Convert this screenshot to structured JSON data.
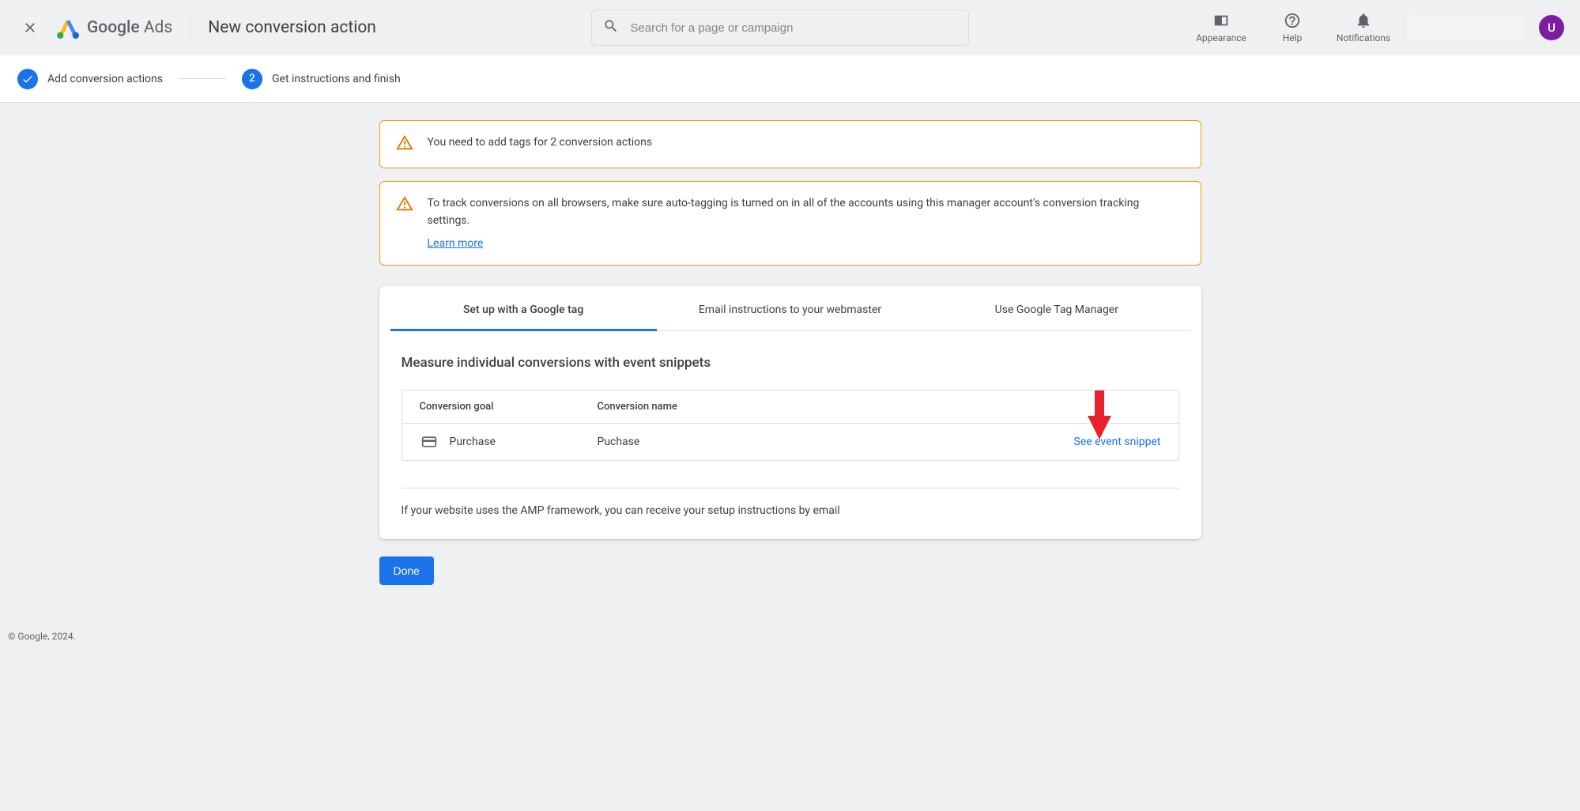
{
  "header": {
    "logo_text_bold": "Google",
    "logo_text_light": "Ads",
    "page_title": "New conversion action",
    "search_placeholder": "Search for a page or campaign",
    "icons": {
      "appearance": "Appearance",
      "help": "Help",
      "notifications": "Notifications"
    },
    "avatar_letter": "U"
  },
  "stepper": {
    "step1_label": "Add conversion actions",
    "step2_number": "2",
    "step2_label": "Get instructions and finish"
  },
  "alerts": {
    "a1": "You need to add tags for 2 conversion actions",
    "a2": "To track conversions on all browsers, make sure auto-tagging is turned on in all of the accounts using this manager account's conversion tracking settings.",
    "a2_link": "Learn more"
  },
  "tabs": {
    "t1": "Set up with a Google tag",
    "t2": "Email instructions to your webmaster",
    "t3": "Use Google Tag Manager"
  },
  "section": {
    "title": "Measure individual conversions with event snippets",
    "col_goal": "Conversion goal",
    "col_name": "Conversion name",
    "row1_goal": "Purchase",
    "row1_name": "Puchase",
    "row1_action": "See event snippet",
    "amp_note": "If your website uses the AMP framework, you can receive your setup instructions by email"
  },
  "done_label": "Done",
  "footer": "© Google, 2024."
}
